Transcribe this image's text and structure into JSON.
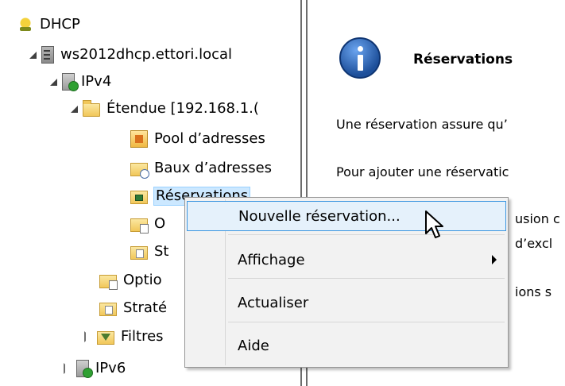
{
  "tree": {
    "items": [
      {
        "label": "DHCP",
        "icon": "dhcp-icon"
      },
      {
        "label": "ws2012dhcp.ettori.local",
        "icon": "server-icon"
      },
      {
        "label": "IPv4",
        "icon": "ipv4-icon"
      },
      {
        "label": "Étendue [192.168.1.(",
        "icon": "folder-icon"
      },
      {
        "label": "Pool d’adresses",
        "icon": "address-pool-icon"
      },
      {
        "label": "Baux d’adresses",
        "icon": "address-leases-icon"
      },
      {
        "label": "Réservations",
        "icon": "reservations-icon"
      },
      {
        "label": "O",
        "icon": "options-icon"
      },
      {
        "label": "St",
        "icon": "policies-icon"
      },
      {
        "label": "Optio",
        "icon": "server-options-icon"
      },
      {
        "label": "Straté",
        "icon": "strategies-icon"
      },
      {
        "label": "Filtres",
        "icon": "filters-icon"
      },
      {
        "label": "IPv6",
        "icon": "ipv6-icon"
      }
    ]
  },
  "info": {
    "title": "Réservations",
    "lines": [
      "Une réservation assure qu’",
      "Pour ajouter une réservatic",
      "usion c",
      "d’excl",
      "ions s"
    ]
  },
  "menu": {
    "items": [
      {
        "label": "Nouvelle réservation..."
      },
      {
        "label": "Affichage"
      },
      {
        "label": "Actualiser"
      },
      {
        "label": "Aide"
      }
    ]
  },
  "colors": {
    "selection_bg": "#cce8ff",
    "menu_highlight_bg": "#e5f1fb",
    "menu_highlight_border": "#3c96e0",
    "menu_bg": "#f2f2f2"
  }
}
